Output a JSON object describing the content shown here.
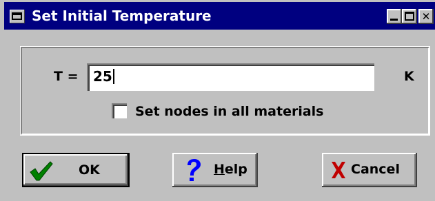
{
  "window": {
    "title": "Set Initial Temperature"
  },
  "form": {
    "t_label": "T =",
    "t_value": "25",
    "unit_label": "K",
    "checkbox_label": "Set nodes in all materials",
    "checkbox_checked": false
  },
  "buttons": {
    "ok_label": "OK",
    "help_prefix": "",
    "help_mnemonic": "H",
    "help_rest": "elp",
    "cancel_label": "Cancel"
  },
  "icons": {
    "system_menu": "window-menu-icon",
    "minimize": "minimize-icon",
    "maximize": "maximize-icon",
    "close": "close-icon",
    "ok": "green-check-icon",
    "help": "blue-question-icon",
    "cancel": "red-x-icon"
  },
  "colors": {
    "title_bar": "#000080",
    "dialog_face": "#c0c0c0",
    "check_green": "#008000",
    "help_blue": "#0000ff",
    "cancel_red": "#c00000"
  }
}
